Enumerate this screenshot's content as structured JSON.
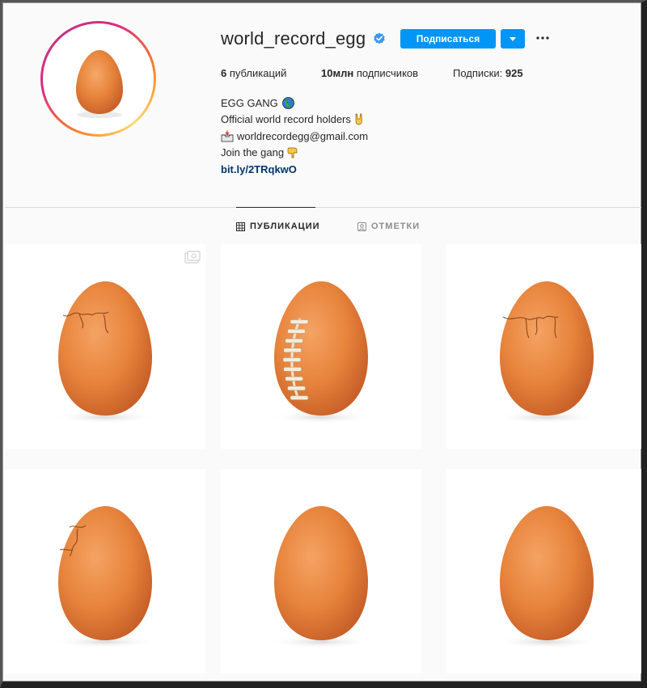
{
  "profile": {
    "username": "world_record_egg",
    "verified": true,
    "follow_label": "Подписаться",
    "stats": {
      "posts_count": "6",
      "posts_label": "публикаций",
      "followers_count": "10млн",
      "followers_label": "подписчиков",
      "following_label": "Подписки:",
      "following_count": "925"
    },
    "full_name": "EGG GANG",
    "bio": {
      "line1": "Official world record holders",
      "line2": "worldrecordegg@gmail.com",
      "line3": "Join the gang"
    },
    "link": "bit.ly/2TRqkwO"
  },
  "tabs": [
    {
      "label": "ПУБЛИКАЦИИ",
      "active": true,
      "icon": "grid-icon"
    },
    {
      "label": "ОТМЕТКИ",
      "active": false,
      "icon": "tagged-icon"
    }
  ],
  "posts": [
    {
      "variant": "cracked",
      "carousel": true
    },
    {
      "variant": "football",
      "carousel": false
    },
    {
      "variant": "cracked-more",
      "carousel": false
    },
    {
      "variant": "cracked-top",
      "carousel": false
    },
    {
      "variant": "plain",
      "carousel": false
    },
    {
      "variant": "plain",
      "carousel": false
    }
  ],
  "colors": {
    "accent": "#0095f6",
    "egg": "#e8823a",
    "link": "#003569"
  }
}
